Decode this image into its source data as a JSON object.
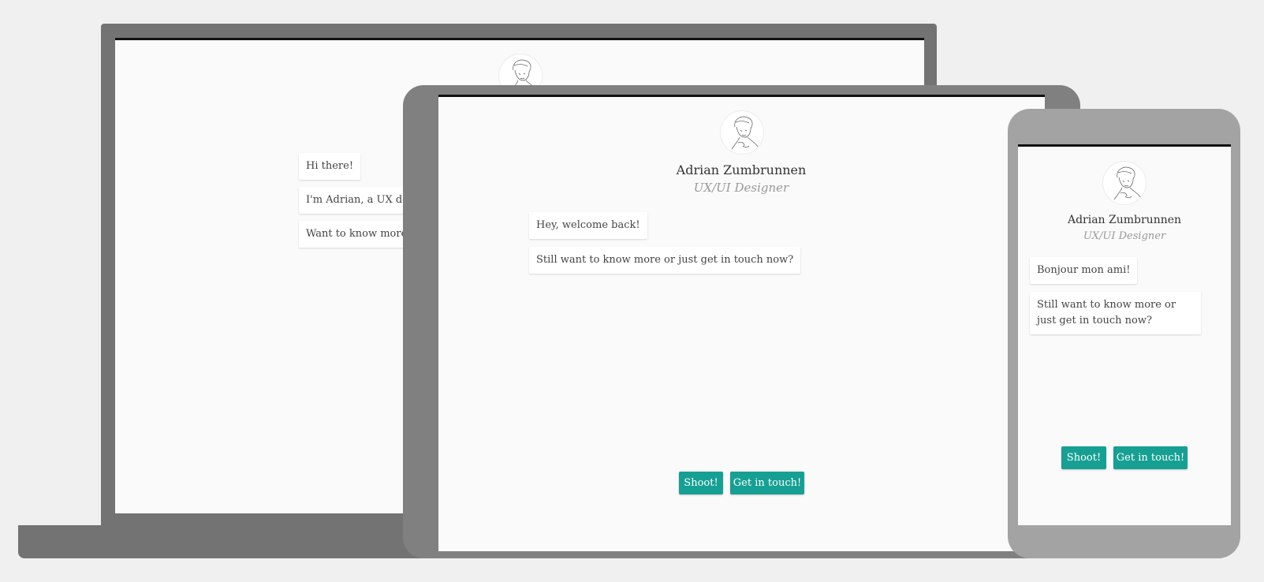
{
  "laptop": {
    "messages": [
      "Hi there!",
      "I'm Adrian, a UX de",
      "Want to know more"
    ]
  },
  "tablet": {
    "name": "Adrian Zumbrunnen",
    "role": "UX/UI Designer",
    "messages": [
      "Hey, welcome back!",
      "Still want to know more or just get in touch now?"
    ],
    "buttons": {
      "shoot": "Shoot!",
      "contact": "Get in touch!"
    }
  },
  "phone": {
    "name": "Adrian Zumbrunnen",
    "role": "UX/UI Designer",
    "messages": [
      "Bonjour mon ami!",
      "Still want to know more or just get in touch now?"
    ],
    "buttons": {
      "shoot": "Shoot!",
      "contact": "Get in touch!"
    }
  },
  "colors": {
    "background": "#f0f0f0",
    "device_dark": "#737373",
    "device_mid": "#808080",
    "device_light": "#a3a3a3",
    "accent": "#16a093"
  }
}
